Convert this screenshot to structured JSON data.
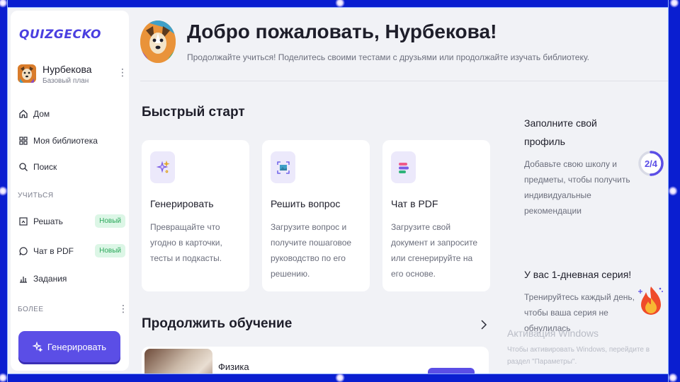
{
  "brand": {
    "logo_text": "QUIZGECKO",
    "accent": "#5b4ee6",
    "frame": "#0a1ed0"
  },
  "user": {
    "name": "Нурбекова",
    "plan": "Базовый план",
    "menu_icon": "kebab-icon"
  },
  "nav": {
    "items": [
      {
        "label": "Дом",
        "icon": "home-icon"
      },
      {
        "label": "Моя библиотека",
        "icon": "grid-icon"
      },
      {
        "label": "Поиск",
        "icon": "search-icon"
      }
    ],
    "section_learn": "УЧИТЬСЯ",
    "learn_items": [
      {
        "label": "Решать",
        "icon": "scan-icon",
        "badge": "Новый"
      },
      {
        "label": "Чат в PDF",
        "icon": "chat-icon",
        "badge": "Новый"
      },
      {
        "label": "Задания",
        "icon": "bar-chart-icon"
      }
    ],
    "section_more": "БОЛЕЕ",
    "generate_label": "Генерировать"
  },
  "header": {
    "title": "Добро пожаловать, Нурбекова!",
    "subtitle": "Продолжайте учиться! Поделитесь своими тестами с друзьями или продолжайте изучать библиотеку."
  },
  "quick_start": {
    "title": "Быстрый старт",
    "cards": [
      {
        "title": "Генерировать",
        "desc": "Превращайте что угодно в карточки, тесты и подкасты.",
        "icon": "sparkles-icon"
      },
      {
        "title": "Решить вопрос",
        "desc": "Загрузите вопрос и получите пошаговое руководство по его решению.",
        "icon": "image-scan-icon"
      },
      {
        "title": "Чат в PDF",
        "desc": "Загрузите свой документ и запросите или сгенерируйте на его основе.",
        "icon": "chat-bubbles-icon"
      }
    ]
  },
  "continue": {
    "title": "Продолжить обучение",
    "item_title": "Физика"
  },
  "profile_card": {
    "title": "Заполните свой профиль",
    "desc": "Добавьте свою школу и предметы, чтобы получить индивидуальные рекомендации",
    "progress_label": "2/4",
    "progress_fraction": 0.5
  },
  "streak_card": {
    "title": "У вас 1-дневная серия!",
    "desc": "Тренируйтесь каждый день, чтобы ваша серия не обнулилась"
  },
  "watermark": {
    "title": "Активация Windows",
    "text": "Чтобы активировать Windows, перейдите в раздел \"Параметры\"."
  }
}
